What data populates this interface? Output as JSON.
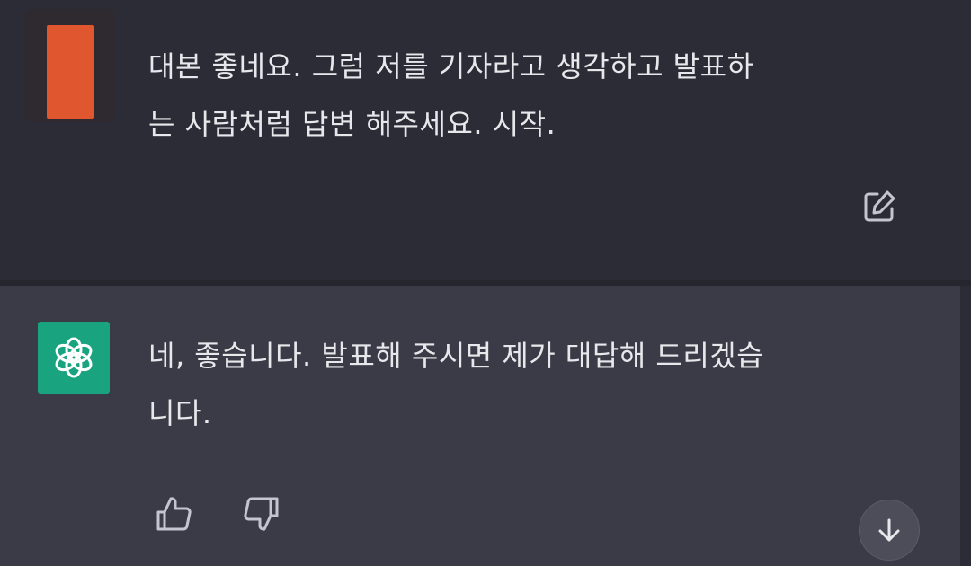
{
  "user_message": {
    "text": "대본 좋네요. 그럼 저를 기자라고 생각하고 발표하\n는 사람처럼 답변 해주세요. 시작.",
    "avatar_color": "#e0562f",
    "edit_icon": "edit-icon"
  },
  "assistant_message": {
    "text": "네, 좋습니다. 발표해 주시면 제가 대답해 드리겠습\n니다.",
    "avatar_color": "#19a37f",
    "avatar_icon": "openai-logo-icon",
    "actions": [
      "thumbs-up-icon",
      "thumbs-down-icon"
    ]
  },
  "scroll_button_icon": "arrow-down-icon"
}
